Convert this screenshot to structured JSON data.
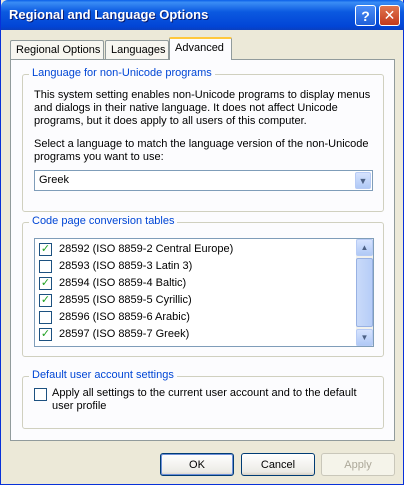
{
  "window": {
    "title": "Regional and Language Options",
    "help_glyph": "?",
    "close_glyph": "✕"
  },
  "tabs": [
    {
      "label": "Regional Options",
      "active": false
    },
    {
      "label": "Languages",
      "active": false
    },
    {
      "label": "Advanced",
      "active": true
    }
  ],
  "non_unicode": {
    "legend": "Language for non-Unicode programs",
    "description_lines": [
      "This system setting enables non-Unicode programs to display menus",
      "and dialogs in their native language. It does not affect Unicode",
      "programs, but it does apply to all users of this computer."
    ],
    "instruction_lines": [
      "Select a language to match the language version of the non-Unicode",
      "programs you want to use:"
    ],
    "selected_language": "Greek"
  },
  "code_pages": {
    "legend": "Code page conversion tables",
    "items": [
      {
        "label": "28592 (ISO 8859-2 Central Europe)",
        "checked": true
      },
      {
        "label": "28593 (ISO 8859-3 Latin 3)",
        "checked": false
      },
      {
        "label": "28594 (ISO 8859-4 Baltic)",
        "checked": true
      },
      {
        "label": "28595 (ISO 8859-5 Cyrillic)",
        "checked": true
      },
      {
        "label": "28596 (ISO 8859-6 Arabic)",
        "checked": false
      },
      {
        "label": "28597 (ISO 8859-7 Greek)",
        "checked": true
      }
    ]
  },
  "default_user": {
    "legend": "Default user account settings",
    "apply_label_lines": [
      "Apply all settings to the current user account and to the default",
      "user profile"
    ],
    "apply_checked": false
  },
  "buttons": {
    "ok": "OK",
    "cancel": "Cancel",
    "apply": "Apply"
  },
  "colors": {
    "title_bar": "#0245d6",
    "legend_text": "#0046d5",
    "check_mark": "#21a121",
    "active_tab_accent": "#ffc83c"
  }
}
